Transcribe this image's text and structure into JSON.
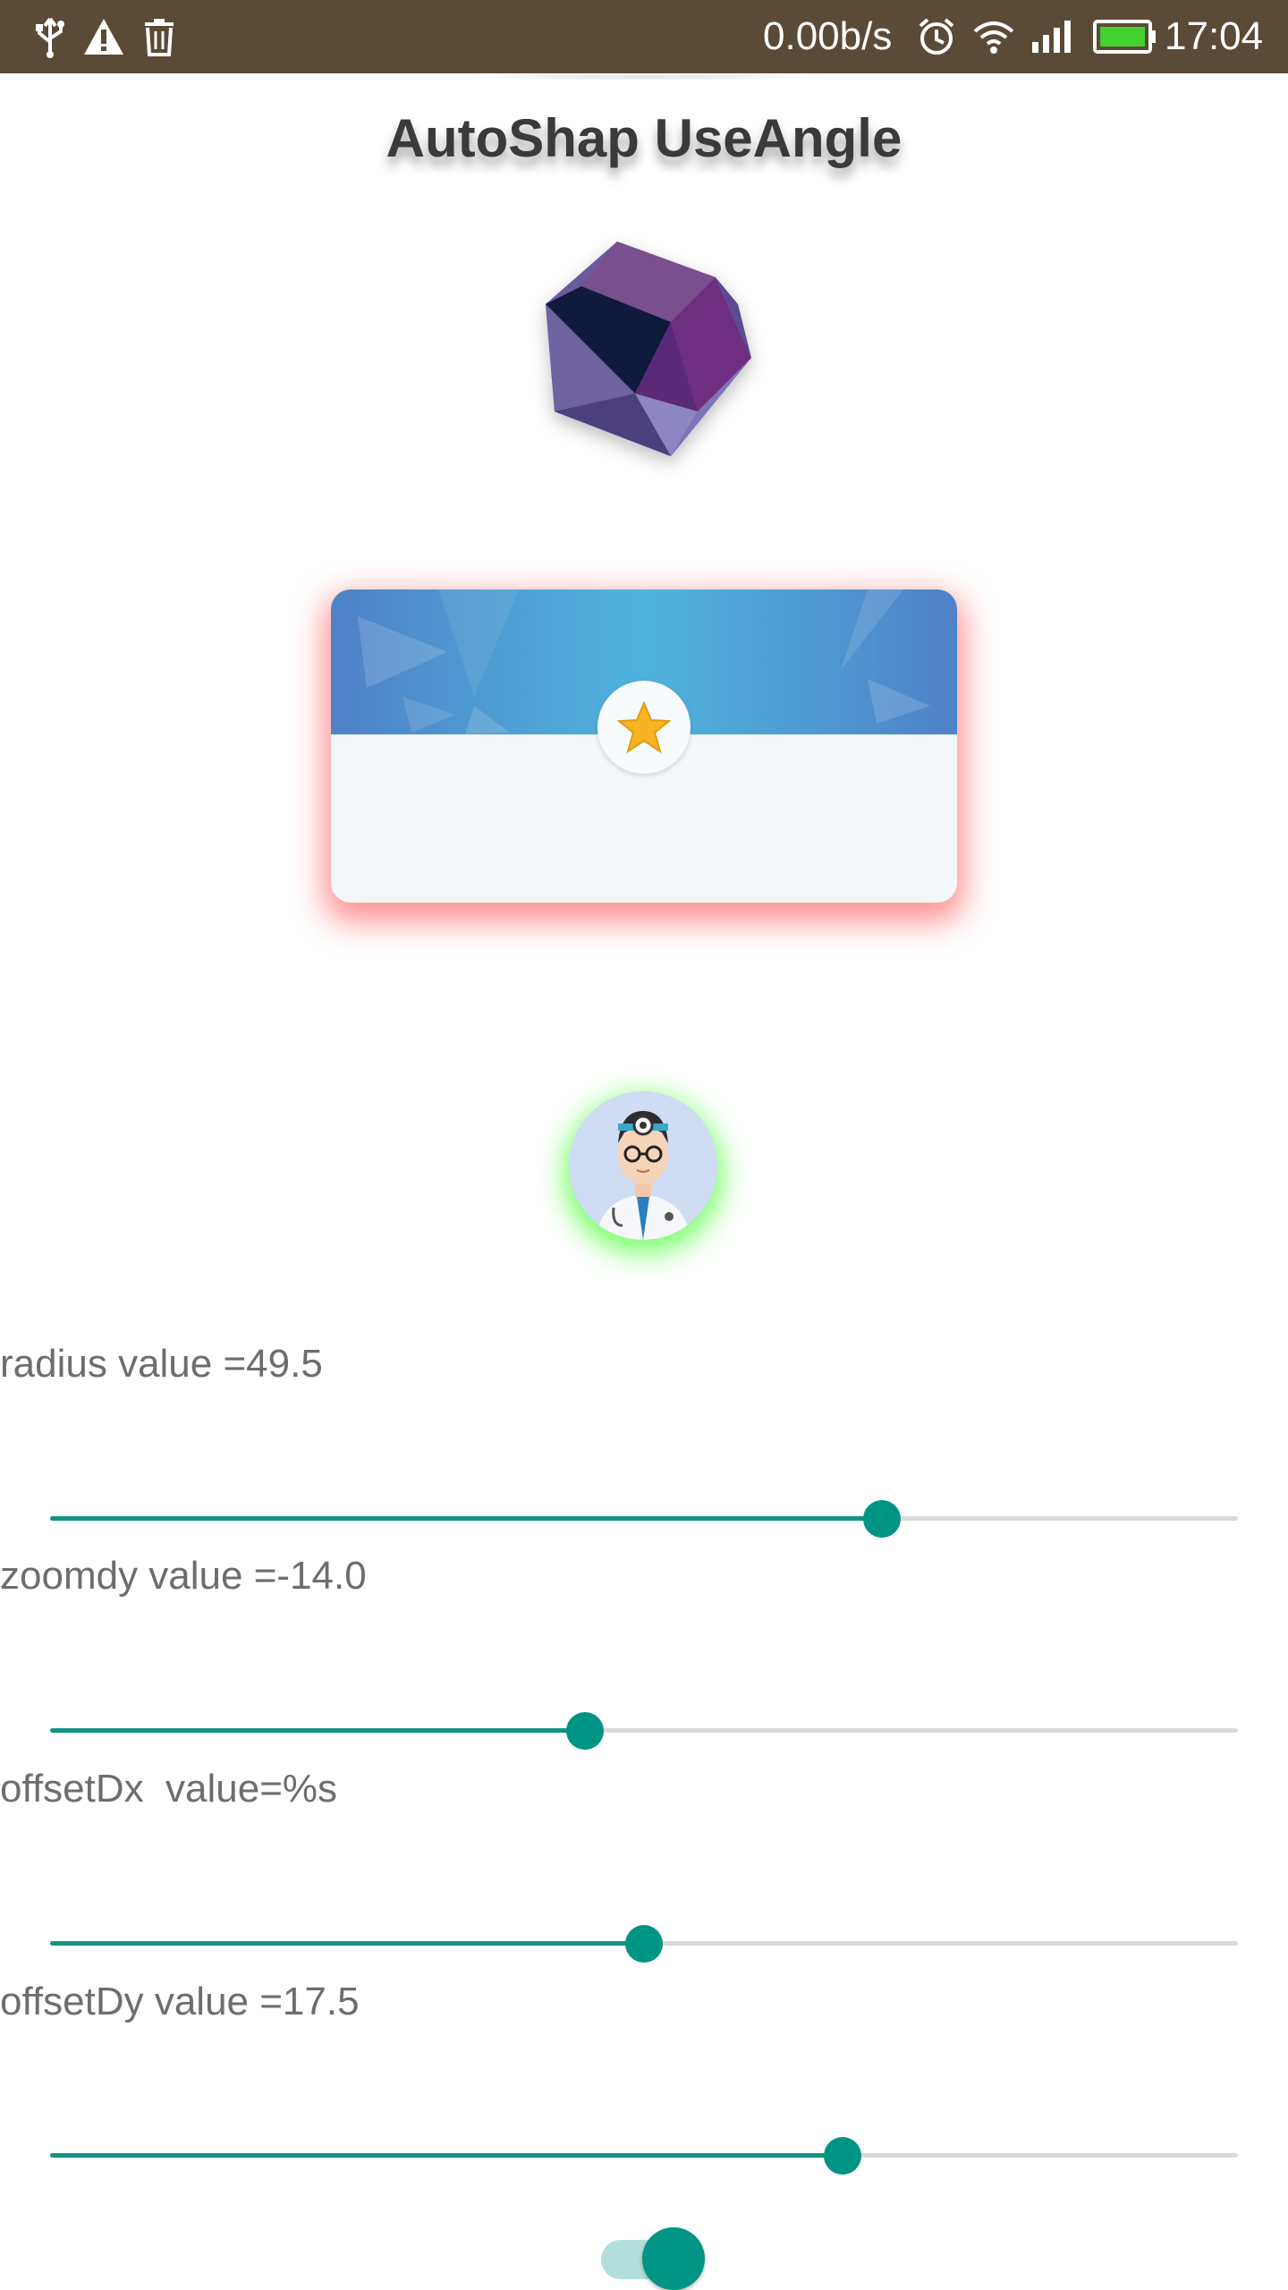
{
  "status_bar": {
    "net_speed": "0.00b/s",
    "time": "17:04",
    "icons": [
      "usb-icon",
      "warning-icon",
      "trash-icon",
      "alarm-icon",
      "wifi-icon",
      "signal-icon",
      "battery-icon"
    ]
  },
  "title": "AutoShap UseAngle",
  "sliders": [
    {
      "label": "radius value =49.5",
      "fraction": 0.7
    },
    {
      "label": "zoomdy value =-14.0",
      "fraction": 0.45
    },
    {
      "label": "offsetDx  value=%s",
      "fraction": 0.5
    },
    {
      "label": "offsetDy value =17.5",
      "fraction": 0.667
    }
  ],
  "toggle": {
    "on": true
  },
  "colors": {
    "status_bar": "#5b4a36",
    "accent": "#009485",
    "card_glow": "#ff3c3c",
    "avatar_glow": "#50ff3c"
  }
}
